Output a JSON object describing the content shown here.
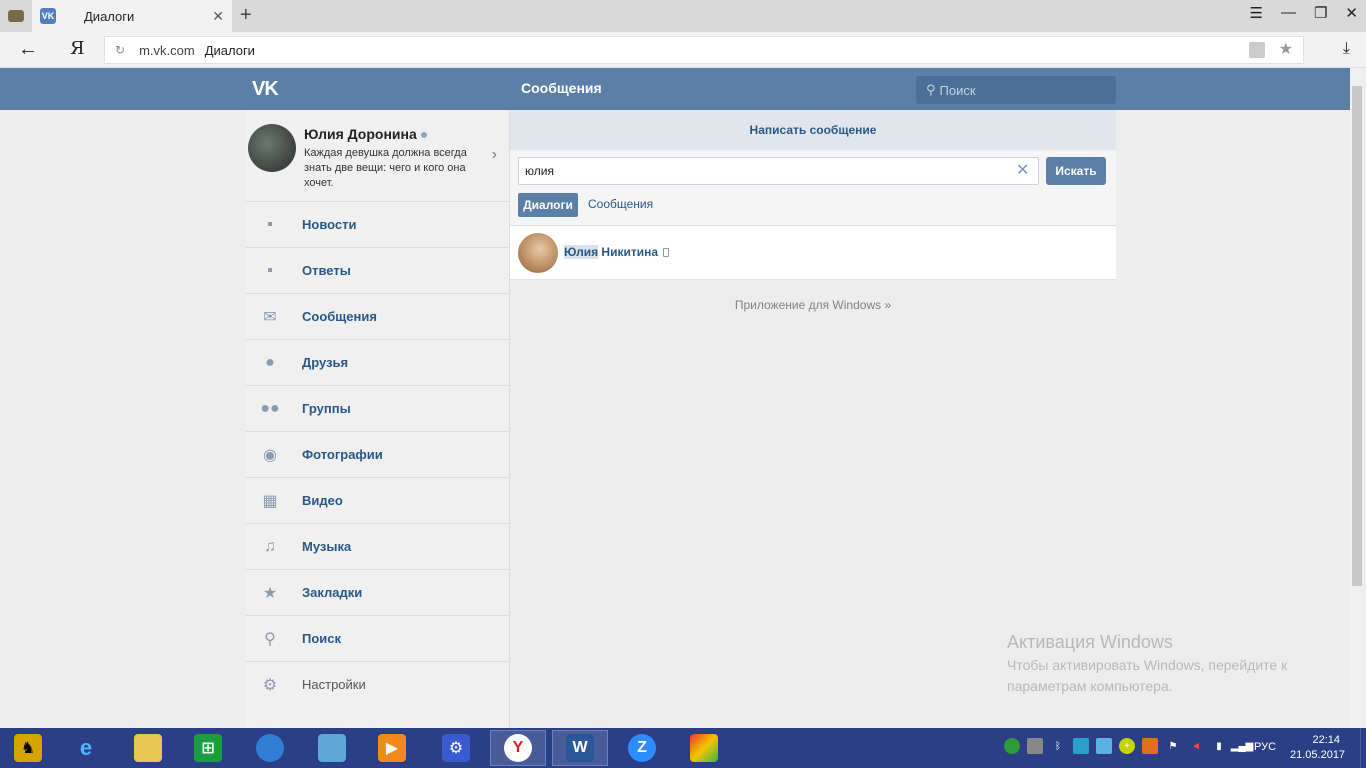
{
  "browser": {
    "tab_title": "Диалоги",
    "new_tab": "+",
    "back": "←",
    "ya": "Я",
    "address_domain": "m.vk.com",
    "address_title": "Диалоги"
  },
  "header": {
    "logo": "VK",
    "page_title": "Сообщения",
    "search_placeholder": "Поиск"
  },
  "profile": {
    "name": "Юлия Доронина",
    "status": "Каждая девушка должна всегда знать две вещи: чего и кого она хочет."
  },
  "menu": [
    {
      "label": "Новости",
      "icon": "news-icon"
    },
    {
      "label": "Ответы",
      "icon": "replies-icon"
    },
    {
      "label": "Сообщения",
      "icon": "envelope-icon"
    },
    {
      "label": "Друзья",
      "icon": "person-icon"
    },
    {
      "label": "Группы",
      "icon": "group-icon"
    },
    {
      "label": "Фотографии",
      "icon": "camera-icon"
    },
    {
      "label": "Видео",
      "icon": "film-icon"
    },
    {
      "label": "Музыка",
      "icon": "music-note-icon"
    },
    {
      "label": "Закладки",
      "icon": "star-icon"
    },
    {
      "label": "Поиск",
      "icon": "search-icon"
    },
    {
      "label": "Настройки",
      "icon": "gear-icon"
    }
  ],
  "main": {
    "write_message": "Написать сообщение",
    "search_value": "юлия",
    "search_button": "Искать",
    "filter_dialogs": "Диалоги",
    "filter_messages": "Сообщения",
    "result": {
      "highlight": "Юлия",
      "rest": " Никитина"
    },
    "app_link": "Приложение для Windows »"
  },
  "watermark": {
    "title": "Активация Windows",
    "text": "Чтобы активировать Windows, перейдите к параметрам компьютера."
  },
  "taskbar": {
    "lang": "РУС",
    "time": "22:14",
    "date": "21.05.2017"
  },
  "colors": {
    "vk_header": "#5b7fa6",
    "link_blue": "#2a5885",
    "taskbar": "#2b3f86"
  }
}
